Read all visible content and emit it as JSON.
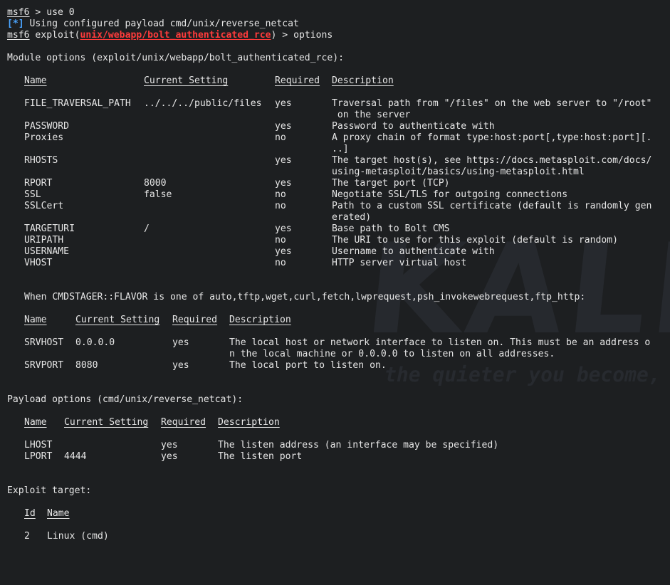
{
  "watermark": {
    "logo": "KALI L",
    "tagline": "the quieter you become, th"
  },
  "prompt": {
    "name": "msf6",
    "cmd1": " > use 0",
    "exploit_word": " exploit(",
    "module": "unix/webapp/bolt_authenticated_rce",
    "cmd2": ") > options"
  },
  "info_line": {
    "marker": "[*]",
    "text": " Using configured payload cmd/unix/reverse_netcat"
  },
  "module_options": {
    "heading": "Module options (exploit/unix/webapp/bolt_authenticated_rce):",
    "headers": {
      "name": "Name",
      "setting": "Current Setting",
      "required": "Required",
      "description": "Description"
    },
    "rows": [
      {
        "name": "FILE_TRAVERSAL_PATH",
        "setting": "../../../public/files",
        "required": "yes",
        "description": "Traversal path from \"/files\" on the web server to \"/root\"",
        "cont": " on the server"
      },
      {
        "name": "PASSWORD",
        "setting": "",
        "required": "yes",
        "description": "Password to authenticate with"
      },
      {
        "name": "Proxies",
        "setting": "",
        "required": "no",
        "description": "A proxy chain of format type:host:port[,type:host:port][.",
        "cont": "..]"
      },
      {
        "name": "RHOSTS",
        "setting": "",
        "required": "yes",
        "description": "The target host(s), see https://docs.metasploit.com/docs/",
        "cont": "using-metasploit/basics/using-metasploit.html"
      },
      {
        "name": "RPORT",
        "setting": "8000",
        "required": "yes",
        "description": "The target port (TCP)"
      },
      {
        "name": "SSL",
        "setting": "false",
        "required": "no",
        "description": "Negotiate SSL/TLS for outgoing connections"
      },
      {
        "name": "SSLCert",
        "setting": "",
        "required": "no",
        "description": "Path to a custom SSL certificate (default is randomly gen",
        "cont": "erated)"
      },
      {
        "name": "TARGETURI",
        "setting": "/",
        "required": "yes",
        "description": "Base path to Bolt CMS"
      },
      {
        "name": "URIPATH",
        "setting": "",
        "required": "no",
        "description": "The URI to use for this exploit (default is random)"
      },
      {
        "name": "USERNAME",
        "setting": "",
        "required": "yes",
        "description": "Username to authenticate with"
      },
      {
        "name": "VHOST",
        "setting": "",
        "required": "no",
        "description": "HTTP server virtual host"
      }
    ]
  },
  "cmdstager": {
    "heading": "When CMDSTAGER::FLAVOR is one of auto,tftp,wget,curl,fetch,lwprequest,psh_invokewebrequest,ftp_http:",
    "headers": {
      "name": "Name",
      "setting": "Current Setting",
      "required": "Required",
      "description": "Description"
    },
    "rows": [
      {
        "name": "SRVHOST",
        "setting": "0.0.0.0",
        "required": "yes",
        "description": "The local host or network interface to listen on. This must be an address o",
        "cont": "n the local machine or 0.0.0.0 to listen on all addresses."
      },
      {
        "name": "SRVPORT",
        "setting": "8080",
        "required": "yes",
        "description": "The local port to listen on."
      }
    ]
  },
  "payload_options": {
    "heading": "Payload options (cmd/unix/reverse_netcat):",
    "headers": {
      "name": "Name",
      "setting": "Current Setting",
      "required": "Required",
      "description": "Description"
    },
    "rows": [
      {
        "name": "LHOST",
        "setting": "",
        "required": "yes",
        "description": "The listen address (an interface may be specified)"
      },
      {
        "name": "LPORT",
        "setting": "4444",
        "required": "yes",
        "description": "The listen port"
      }
    ]
  },
  "exploit_target": {
    "heading": "Exploit target:",
    "headers": {
      "id": "Id",
      "name": "Name"
    },
    "rows": [
      {
        "id": "2",
        "name": "Linux (cmd)"
      }
    ]
  }
}
